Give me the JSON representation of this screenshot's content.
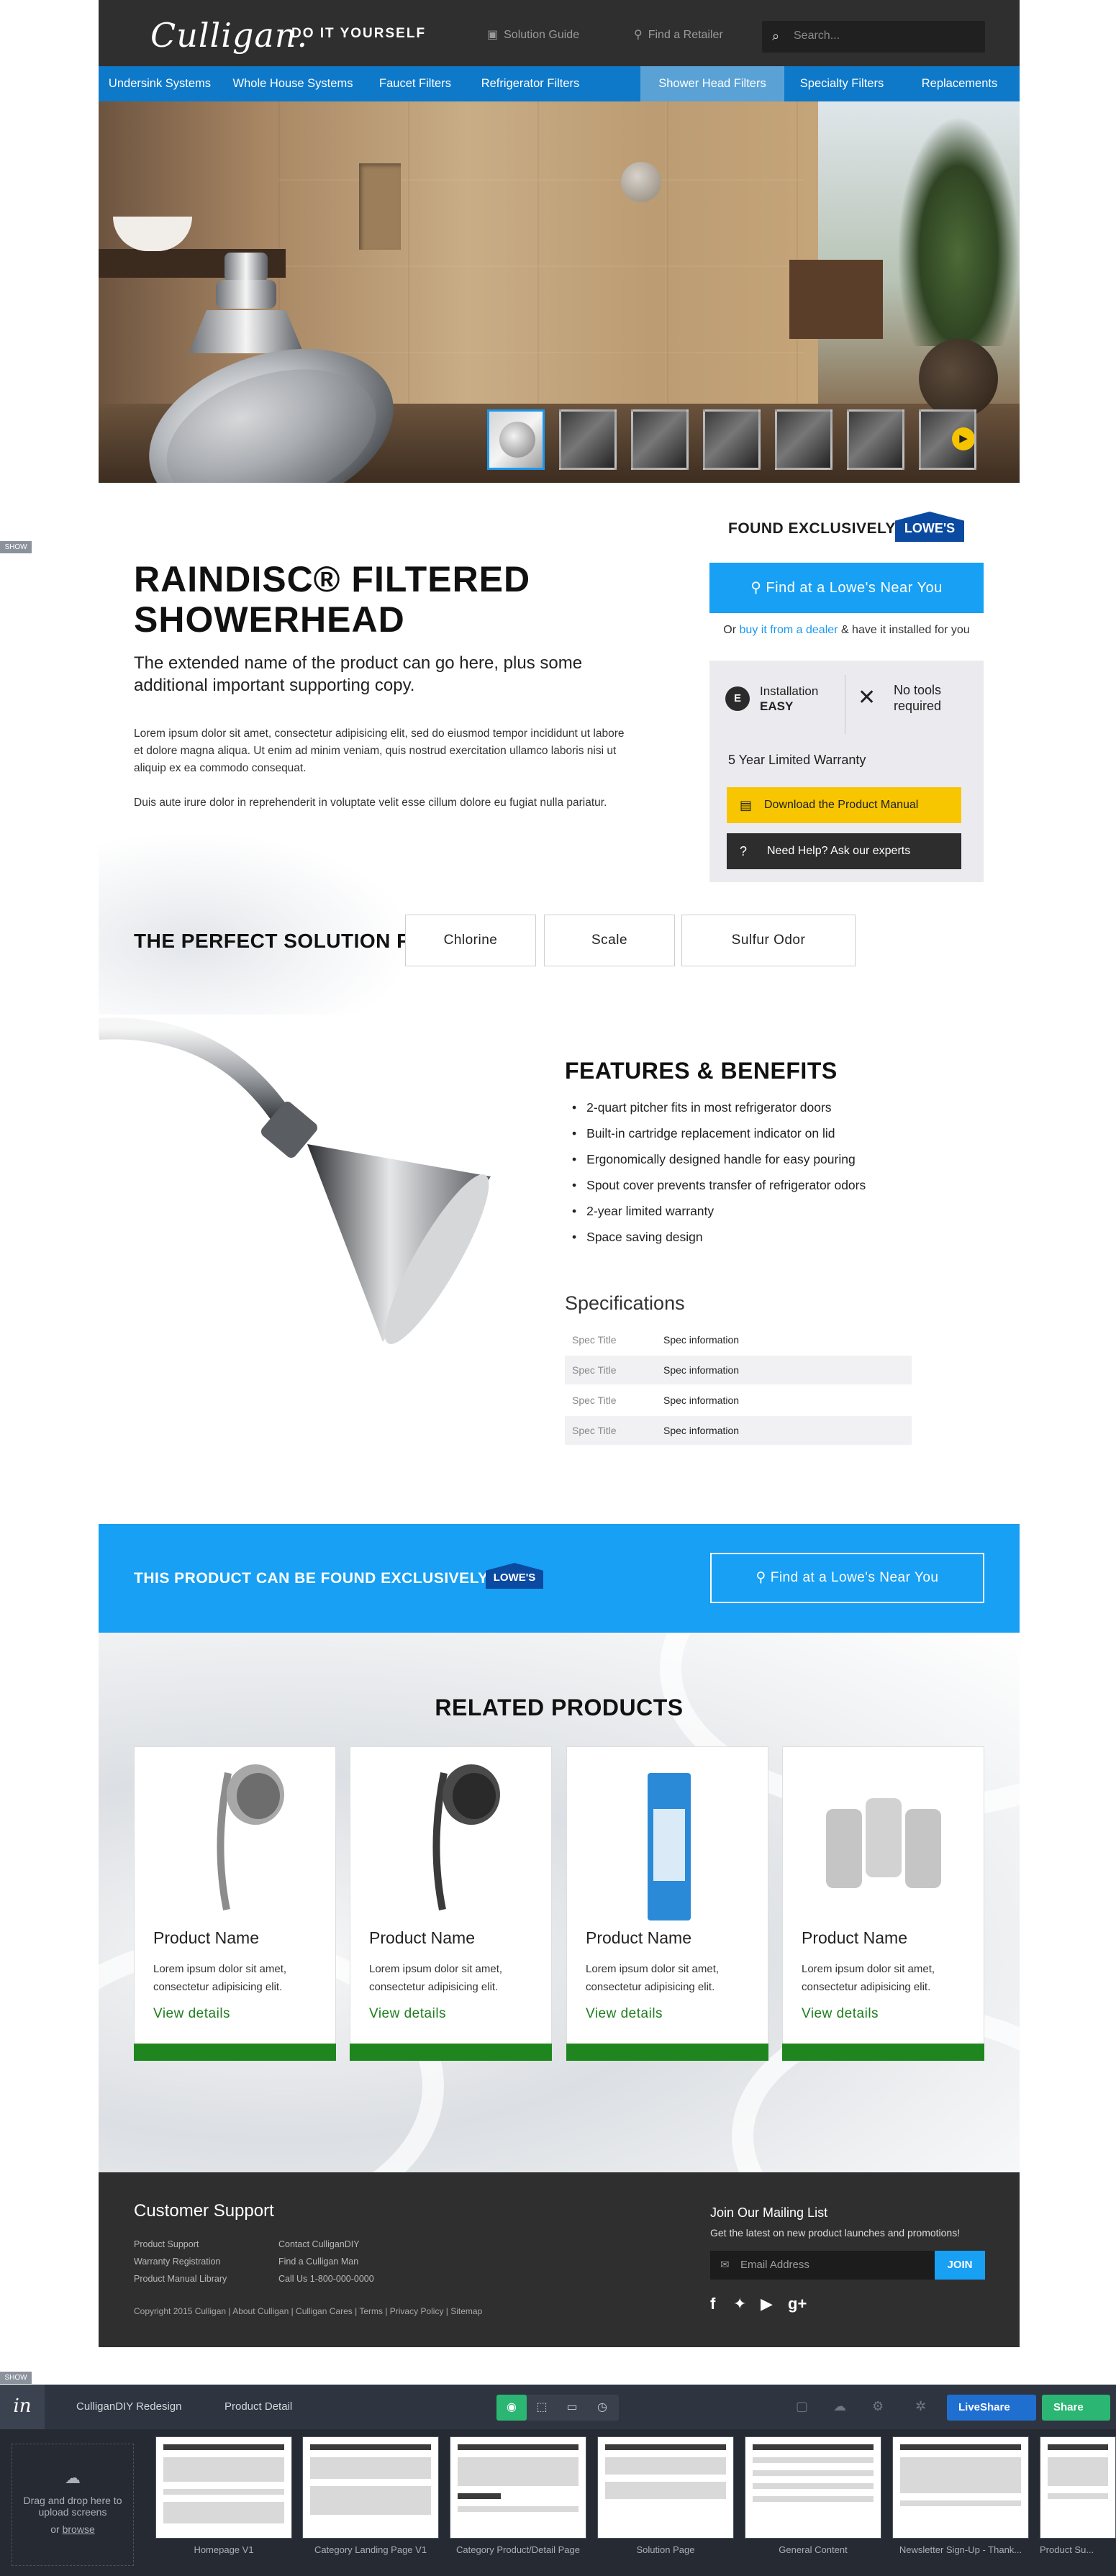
{
  "header": {
    "logo": "Culligan.",
    "tagline": "DO IT YOURSELF",
    "solution_guide": "Solution Guide",
    "find_retailer": "Find a Retailer",
    "search_placeholder": "Search..."
  },
  "nav": [
    "Undersink Systems",
    "Whole House Systems",
    "Faucet Filters",
    "Refrigerator Filters",
    "Shower Head Filters",
    "Specialty Filters",
    "Replacements"
  ],
  "nav_active": "Shower Head Filters",
  "product": {
    "found_label": "FOUND EXCLUSIVELY AT",
    "retailer": "LOWE'S",
    "title": "RAINDISC® FILTERED SHOWERHEAD",
    "subtitle": "The extended name of the product can go here, plus some additional important supporting copy.",
    "para1": "Lorem ipsum dolor sit amet, consectetur adipisicing elit, sed do eiusmod tempor incididunt ut labore et dolore magna aliqua. Ut enim ad minim veniam, quis nostrud exercitation ullamco laboris nisi ut aliquip ex ea commodo consequat.",
    "para2": "Duis aute irure dolor in reprehenderit in voluptate velit esse cillum dolore eu fugiat nulla pariatur.",
    "find_btn": "Find at a Lowe's Near You",
    "dealer_prefix": "Or",
    "dealer_link": "buy it from a dealer",
    "dealer_suffix": "& have it installed for you",
    "install_icon": "E",
    "install_label": "Installation",
    "install_value": "EASY",
    "tools_label": "No tools required",
    "warranty": "5 Year Limited Warranty",
    "manual_btn": "Download the Product Manual",
    "help_btn": "Need Help? Ask our experts"
  },
  "solution": {
    "title": "THE PERFECT SOLUTION FOR",
    "chips": [
      "Chlorine",
      "Scale",
      "Sulfur Odor"
    ]
  },
  "features": {
    "title": "FEATURES & BENEFITS",
    "items": [
      "2-quart pitcher fits in most refrigerator doors",
      "Built-in cartridge replacement indicator on lid",
      "Ergonomically designed handle for easy pouring",
      "Spout cover prevents transfer of refrigerator odors",
      "2-year limited warranty",
      "Space saving design"
    ]
  },
  "specs": {
    "title": "Specifications",
    "rows": [
      {
        "key": "Spec Title",
        "value": "Spec information"
      },
      {
        "key": "Spec Title",
        "value": "Spec information"
      },
      {
        "key": "Spec Title",
        "value": "Spec information"
      },
      {
        "key": "Spec Title",
        "value": "Spec information"
      }
    ]
  },
  "banner": {
    "text": "THIS PRODUCT CAN BE FOUND EXCLUSIVELY AT",
    "btn": "Find at a Lowe's Near You"
  },
  "related": {
    "title": "RELATED PRODUCTS",
    "cards": [
      {
        "name": "Product Name",
        "desc": "Lorem ipsum dolor sit amet, consectetur adipisicing elit.",
        "link": "View details"
      },
      {
        "name": "Product Name",
        "desc": "Lorem ipsum dolor sit amet, consectetur adipisicing elit.",
        "link": "View details"
      },
      {
        "name": "Product Name",
        "desc": "Lorem ipsum dolor sit amet, consectetur adipisicing elit.",
        "link": "View details"
      },
      {
        "name": "Product Name",
        "desc": "Lorem ipsum dolor sit amet, consectetur adipisicing elit.",
        "link": "View details"
      }
    ]
  },
  "footer": {
    "support_title": "Customer Support",
    "col1": [
      "Product Support",
      "Warranty Registration",
      "Product Manual Library"
    ],
    "col2": [
      "Contact CulliganDIY",
      "Find a Culligan Man",
      "Call Us 1-800-000-0000"
    ],
    "copyright": "Copyright 2015 Culligan  |  About Culligan  |  Culligan Cares  |  Terms  |  Privacy Policy  |  Sitemap",
    "mail_title": "Join Our Mailing List",
    "mail_sub": "Get the latest on new product launches and promotions!",
    "mail_placeholder": "Email Address",
    "mail_btn": "JOIN"
  },
  "invision": {
    "show": "SHOW",
    "project": "CulliganDIY Redesign",
    "screen": "Product Detail",
    "liveshare": "LiveShare",
    "share": "Share",
    "upload_line1": "Drag and drop here to",
    "upload_line2": "upload screens",
    "upload_or": "or",
    "upload_link": "browse",
    "screens": [
      "Homepage V1",
      "Category Landing Page V1",
      "Category Product/Detail Page",
      "Solution Page",
      "General Content",
      "Newsletter Sign-Up - Thank...",
      "Product Su..."
    ]
  },
  "colors": {
    "brand_blue": "#0e79c9",
    "accent_blue": "#17a0f4",
    "dark": "#2f2f2f",
    "yellow": "#f7c600",
    "green": "#1f861f"
  }
}
